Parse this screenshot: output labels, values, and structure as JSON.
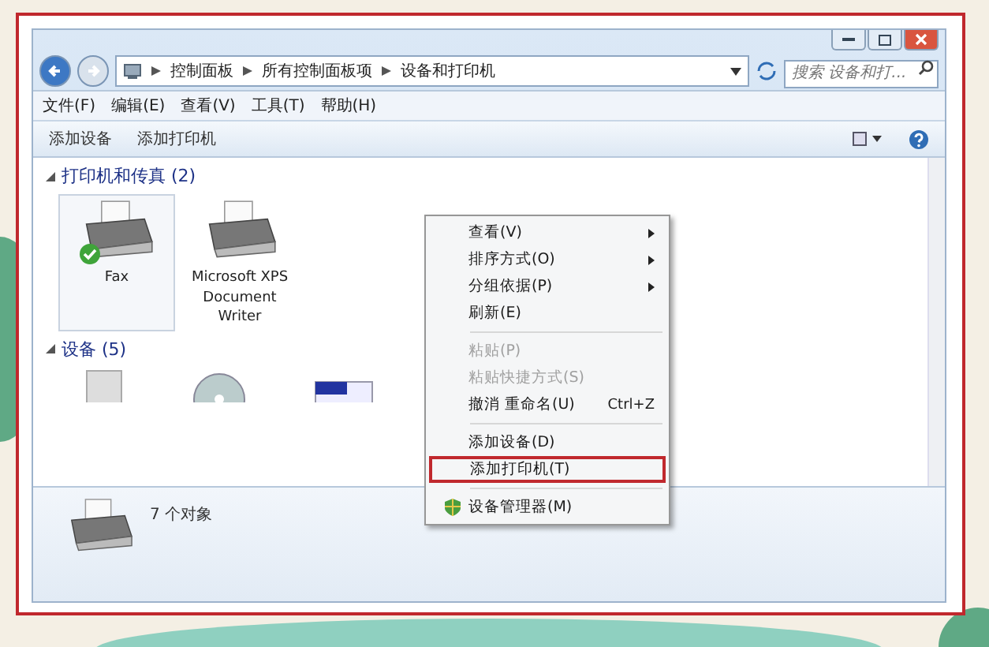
{
  "address_bar": {
    "crumbs": [
      "控制面板",
      "所有控制面板项",
      "设备和打印机"
    ],
    "search_placeholder": "搜索 设备和打..."
  },
  "menu_bar": [
    "文件(F)",
    "编辑(E)",
    "查看(V)",
    "工具(T)",
    "帮助(H)"
  ],
  "command_bar": [
    "添加设备",
    "添加打印机"
  ],
  "groups": [
    {
      "title": "打印机和传真 (2)",
      "expanded": true,
      "items": [
        {
          "label": "Fax",
          "selected": true,
          "is_default": true
        },
        {
          "label": "Microsoft XPS Document Writer",
          "selected": false,
          "is_default": false
        }
      ]
    },
    {
      "title": "设备 (5)",
      "expanded": true
    }
  ],
  "context_menu": [
    {
      "kind": "item",
      "label": "查看(V)",
      "submenu": true,
      "disabled": false,
      "highlighted": false
    },
    {
      "kind": "item",
      "label": "排序方式(O)",
      "submenu": true,
      "disabled": false,
      "highlighted": false
    },
    {
      "kind": "item",
      "label": "分组依据(P)",
      "submenu": true,
      "disabled": false,
      "highlighted": false
    },
    {
      "kind": "item",
      "label": "刷新(E)",
      "submenu": false,
      "disabled": false,
      "highlighted": false
    },
    {
      "kind": "separator"
    },
    {
      "kind": "item",
      "label": "粘贴(P)",
      "submenu": false,
      "disabled": true,
      "highlighted": false
    },
    {
      "kind": "item",
      "label": "粘贴快捷方式(S)",
      "submenu": false,
      "disabled": true,
      "highlighted": false
    },
    {
      "kind": "item",
      "label": "撤消 重命名(U)",
      "shortcut": "Ctrl+Z",
      "submenu": false,
      "disabled": false,
      "highlighted": false
    },
    {
      "kind": "separator"
    },
    {
      "kind": "item",
      "label": "添加设备(D)",
      "submenu": false,
      "disabled": false,
      "highlighted": false
    },
    {
      "kind": "item",
      "label": "添加打印机(T)",
      "submenu": false,
      "disabled": false,
      "highlighted": true
    },
    {
      "kind": "separator"
    },
    {
      "kind": "shield_item",
      "label": "设备管理器(M)",
      "submenu": false,
      "disabled": false,
      "highlighted": false
    }
  ],
  "details_pane": {
    "count": "7 个对象"
  }
}
